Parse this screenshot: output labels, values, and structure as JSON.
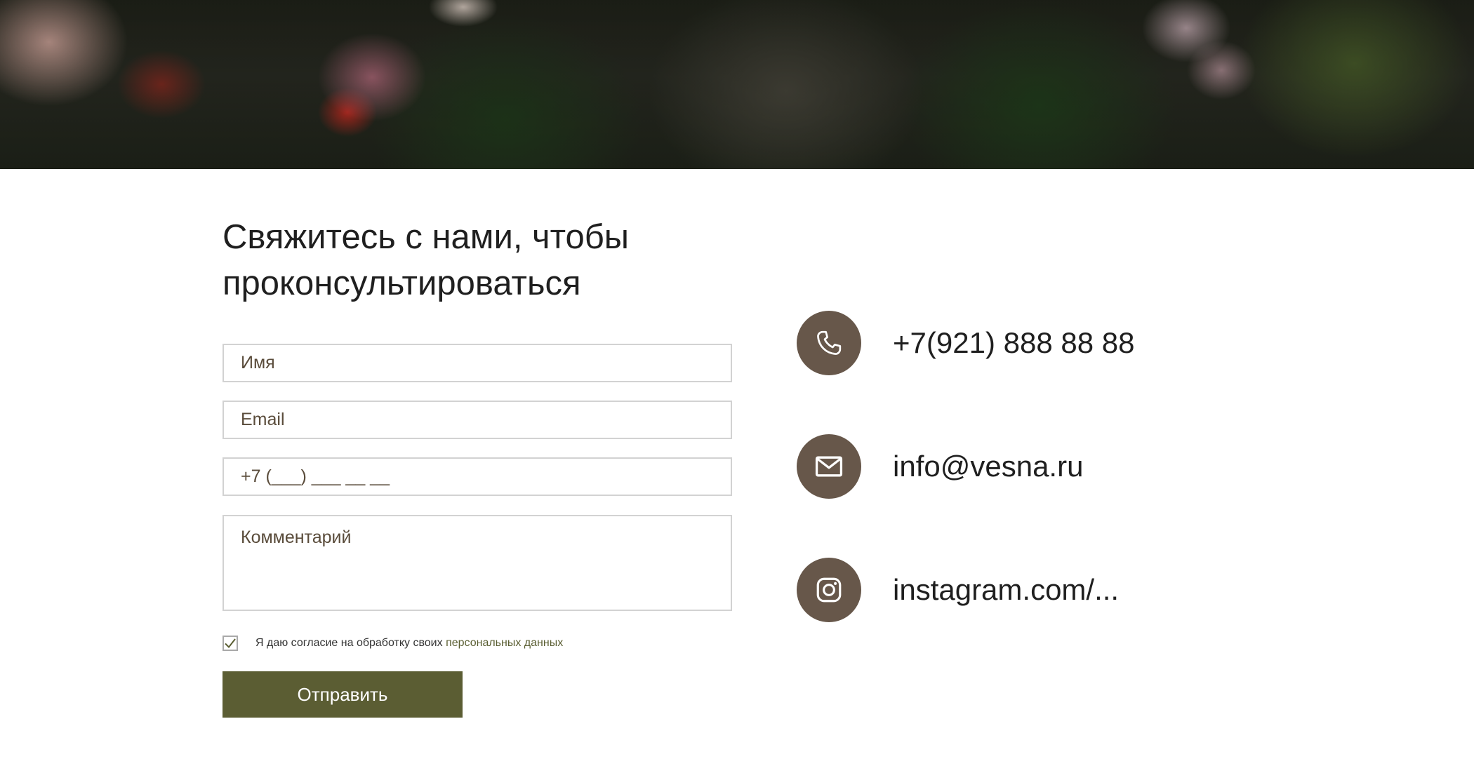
{
  "form": {
    "heading": "Свяжитесь с нами, чтобы проконсультироваться",
    "name_placeholder": "Имя",
    "email_placeholder": "Email",
    "phone_placeholder": "+7 (___) ___ __ __",
    "comment_placeholder": "Комментарий",
    "consent_checked": true,
    "consent_text": "Я даю согласие на обработку своих ",
    "consent_link": "персональных данных",
    "submit_label": "Отправить"
  },
  "contacts": {
    "phone": {
      "icon": "phone-icon",
      "text": "+7(921) 888 88 88"
    },
    "email": {
      "icon": "envelope-icon",
      "text": "info@vesna.ru"
    },
    "instagram": {
      "icon": "instagram-icon",
      "text": "instagram.com/..."
    }
  },
  "colors": {
    "accent_button": "#5b5d33",
    "icon_circle": "#67574a",
    "link": "#5a5e32",
    "placeholder": "#5a4c3b"
  }
}
